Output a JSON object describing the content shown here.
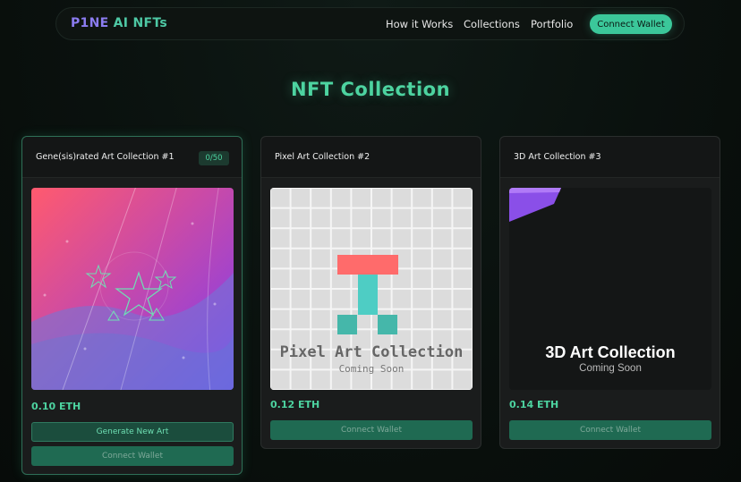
{
  "nav": {
    "logo_part1": "P1NE",
    "logo_part2": " AI NFTs",
    "links": [
      "How it Works",
      "Collections",
      "Portfolio"
    ],
    "cta": "Connect Wallet"
  },
  "page": {
    "title": "NFT Collection"
  },
  "colors": {
    "accent": "#4dd3a0",
    "logo_purple": "#8b7cf0",
    "button": "#1f6a52"
  },
  "cards": [
    {
      "title": "Gene(sis)rated Art Collection #1",
      "badge": "0/50",
      "price": "0.10 ETH",
      "generate_label": "Generate New Art",
      "wallet_label": "Connect Wallet"
    },
    {
      "title": "Pixel Art Collection #2",
      "art_title": "Pixel Art Collection",
      "art_subtitle": "Coming Soon",
      "price": "0.12 ETH",
      "wallet_label": "Connect Wallet"
    },
    {
      "title": "3D Art Collection #3",
      "art_title": "3D Art Collection",
      "art_subtitle": "Coming Soon",
      "price": "0.14 ETH",
      "wallet_label": "Connect Wallet"
    }
  ]
}
